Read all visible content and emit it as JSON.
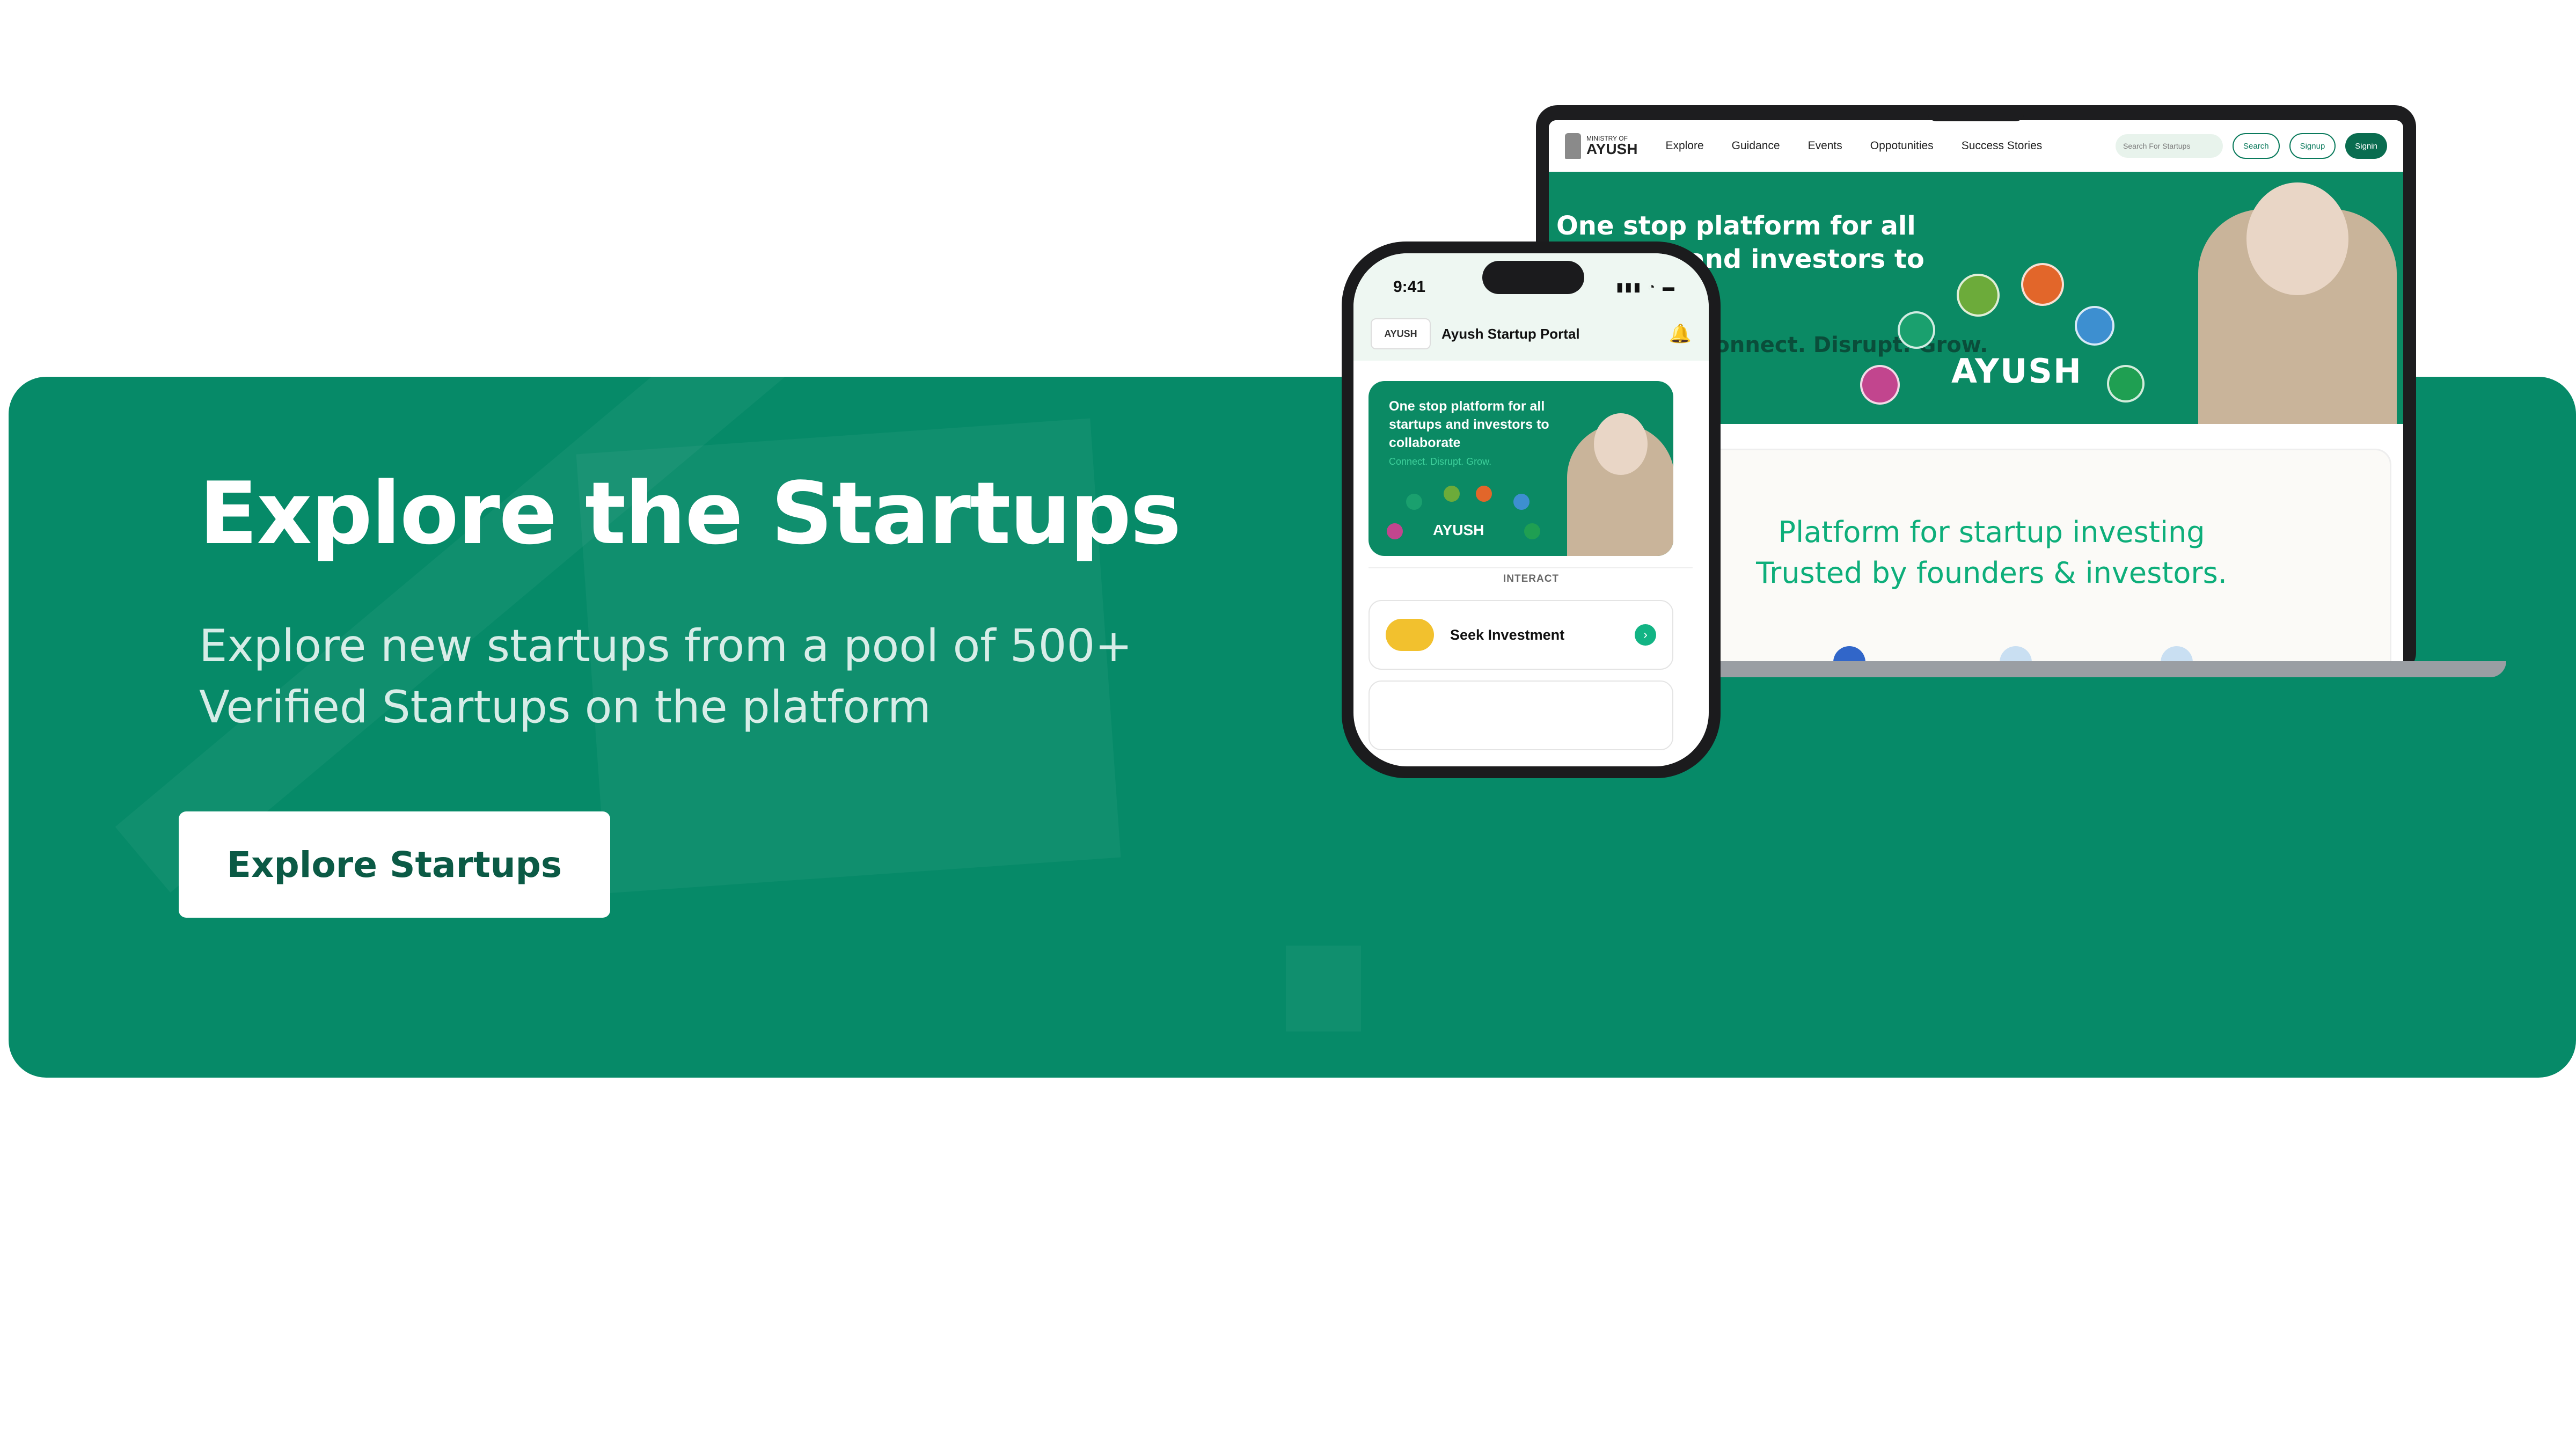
{
  "banner": {
    "headline": "Explore the Startups",
    "subtext_line1": "Explore new startups from a pool of 500+",
    "subtext_line2": "Verified Startups on the platform",
    "cta_label": "Explore Startups",
    "background_color": "#068a68"
  },
  "laptop_site": {
    "logo_small": "MINISTRY OF",
    "logo_big": "AYUSH",
    "nav": [
      "Explore",
      "Guidance",
      "Events",
      "Oppotunities",
      "Success Stories"
    ],
    "search_placeholder": "Search For Startups",
    "search_button": "Search",
    "signup": "Signup",
    "signin": "Signin",
    "hero_title": "One stop platform for all startups and investors to",
    "hero_tagline": "Connect. Disrupt. Grow.",
    "hero_word": "AYUSH",
    "platform_line1": "Platform for startup investing",
    "platform_line2": "Trusted by founders & investors."
  },
  "phone_app": {
    "time": "9:41",
    "status_icons": "▮▮▮ ◔ ▬",
    "logo": "AYUSH",
    "app_title": "Ayush Startup Portal",
    "card_title": "One stop platform for all startups and investors to collaborate",
    "card_tagline": "Connect. Disrupt. Grow.",
    "card_word": "AYUSH",
    "section_label": "INTERACT",
    "seek_label": "Seek Investment",
    "go_symbol": "›"
  },
  "icons": {
    "bell": "bell-icon",
    "arrow": "chevron-right-icon"
  }
}
